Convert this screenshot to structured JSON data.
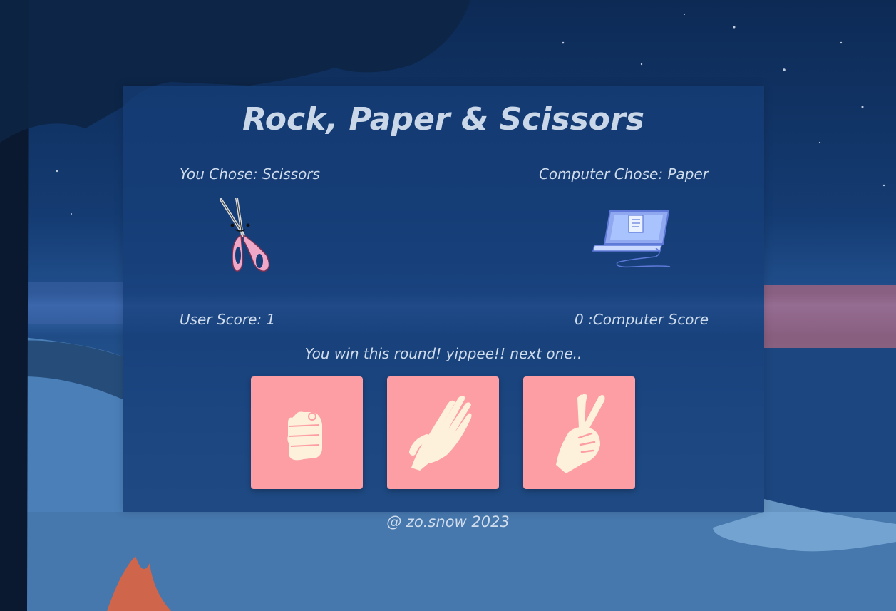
{
  "game": {
    "title": "Rock, Paper & Scissors",
    "user_choice_label": "You Chose: Scissors",
    "computer_choice_label": "Computer Chose: Paper",
    "user_score_label": "User Score: 1",
    "computer_score_label": "0 :Computer Score",
    "result_message": "You win this round! yippee!! next one..",
    "user_choice_icon": "scissors-icon",
    "computer_choice_icon": "laptop-icon"
  },
  "buttons": [
    {
      "name": "rock",
      "icon": "fist-icon"
    },
    {
      "name": "paper",
      "icon": "open-hand-icon"
    },
    {
      "name": "scissors",
      "icon": "peace-hand-icon"
    }
  ],
  "footer": {
    "credit": "@ zo.snow 2023"
  },
  "colors": {
    "button_bg": "#fd9ea4",
    "hand_fill": "#fdf1dc",
    "panel_bg": "#163e78",
    "text": "#cfdcec"
  }
}
